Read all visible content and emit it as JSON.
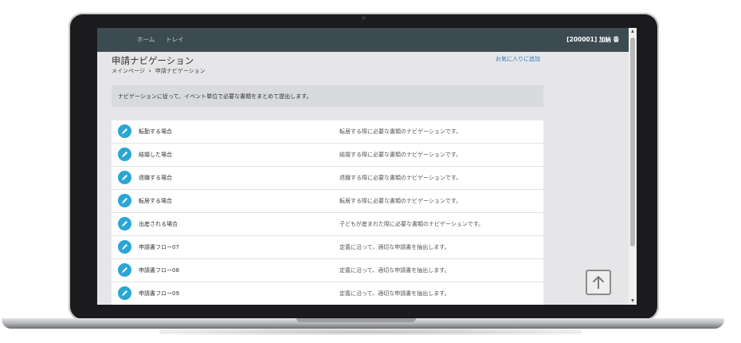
{
  "topbar": {
    "nav": [
      "ホーム",
      "トレイ"
    ],
    "user": "[200001]  加納 香"
  },
  "page": {
    "title": "申請ナビゲーション",
    "favorite_link": "お気に入りに追加",
    "breadcrumb": [
      "メインページ",
      "申請ナビゲーション"
    ],
    "breadcrumb_sep": "›",
    "info": "ナビゲーションに従って、イベント単位で必要な書類をまとめて提出します。"
  },
  "list": [
    {
      "label": "転勤する場合",
      "desc": "転居する際に必要な書類のナビゲーションです。",
      "icon": "pencil-icon"
    },
    {
      "label": "結婚した場合",
      "desc": "結婚する際に必要な書類のナビゲーションです。",
      "icon": "pencil-icon"
    },
    {
      "label": "退職する場合",
      "desc": "退職する際に必要な書類のナビゲーションです。",
      "icon": "pencil-icon"
    },
    {
      "label": "転居する場合",
      "desc": "転居する際に必要な書類のナビゲーションです。",
      "icon": "pencil-icon"
    },
    {
      "label": "出産される場合",
      "desc": "子どもが産まれた際に必要な書類のナビゲーションです。",
      "icon": "pencil-icon"
    },
    {
      "label": "申請書フロー07",
      "desc": "定義に沿って、適切な申請書を抽出します。",
      "icon": "pencil-icon"
    },
    {
      "label": "申請書フロー08",
      "desc": "定義に沿って、適切な申請書を抽出します。",
      "icon": "pencil-icon"
    },
    {
      "label": "申請書フロー09",
      "desc": "定義に沿って、適切な申請書を抽出します。",
      "icon": "pencil-icon"
    }
  ],
  "colors": {
    "topbar": "#3c4a52",
    "accent_icon": "#2aa6d5",
    "link": "#2a7bbf"
  },
  "icons": {
    "scroll_to_top": "arrow-up-icon"
  }
}
